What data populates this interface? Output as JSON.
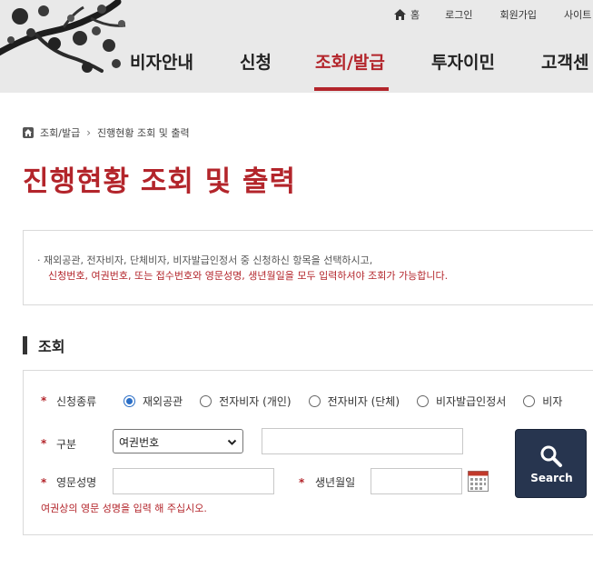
{
  "header": {
    "util": {
      "home": "홈",
      "login": "로그인",
      "signup": "회원가입",
      "sitemap": "사이트"
    },
    "gnb": [
      "비자안내",
      "신청",
      "조회/발급",
      "투자이민",
      "고객센"
    ],
    "active_index": 2
  },
  "breadcrumb": {
    "item1": "조회/발급",
    "item2": "진행현황 조회 및 출력"
  },
  "page_title": "진행현황 조회 및 출력",
  "notice": {
    "line1": "· 재외공관, 전자비자, 단체비자, 비자발급인정서 중 신청하신 항목을 선택하시고,",
    "line2": "신청번호, 여권번호, 또는 접수번호와 영문성명, 생년월일을 모두 입력하셔야 조회가 가능합니다."
  },
  "section_title": "조회",
  "form": {
    "required_mark": "*",
    "type_label": "신청종류",
    "radios": [
      "재외공관",
      "전자비자 (개인)",
      "전자비자 (단체)",
      "비자발급인정서",
      "비자"
    ],
    "selected_radio": 0,
    "division_label": "구분",
    "division_value": "여권번호",
    "name_label": "영문성명",
    "birth_label": "생년월일",
    "hint": "여권상의 영문 성명을 입력 해 주십시오.",
    "search_label": "Search"
  },
  "colors": {
    "accent": "#b3252b",
    "button": "#27354f",
    "radio_selected": "#2a6ec6"
  },
  "icons": {
    "home": "home-icon",
    "calendar": "calendar-icon",
    "search": "search-icon",
    "dropdown": "chevron-down-icon"
  }
}
